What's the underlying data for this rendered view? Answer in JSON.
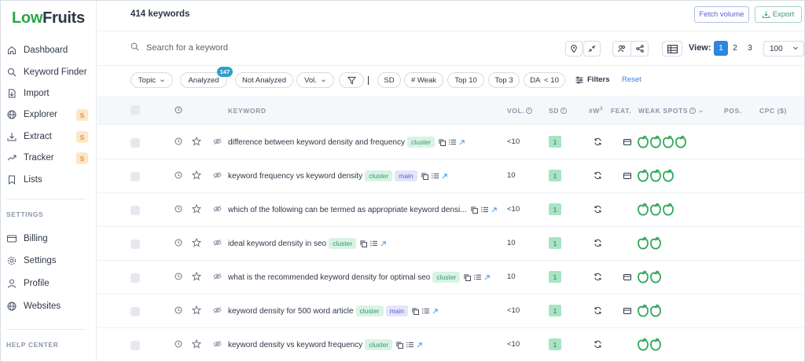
{
  "app": {
    "logo_part1": "LowFruits",
    "logo_brand_color": "#28a745"
  },
  "sidebar": {
    "items": [
      {
        "label": "Dashboard",
        "icon": "home-icon"
      },
      {
        "label": "Keyword Finder",
        "icon": "search-icon"
      },
      {
        "label": "Import",
        "icon": "import-icon"
      },
      {
        "label": "Explorer",
        "icon": "globe-icon",
        "badge": "S"
      },
      {
        "label": "Extract",
        "icon": "download-icon",
        "badge": "S"
      },
      {
        "label": "Tracker",
        "icon": "trend-icon",
        "badge": "S"
      },
      {
        "label": "Lists",
        "icon": "bookmark-icon"
      }
    ],
    "settings_heading": "SETTINGS",
    "settings_items": [
      {
        "label": "Billing",
        "icon": "card-icon"
      },
      {
        "label": "Settings",
        "icon": "gear-icon"
      },
      {
        "label": "Profile",
        "icon": "user-icon"
      },
      {
        "label": "Websites",
        "icon": "globe-icon"
      }
    ],
    "help_heading": "HELP CENTER"
  },
  "header": {
    "keyword_count": "414 keywords",
    "fetch_volume_label": "Fetch volume",
    "export_label": "Export"
  },
  "search": {
    "placeholder": "Search for a keyword",
    "view_label": "View:",
    "pages": [
      "1",
      "2",
      "3"
    ],
    "active_page": "1",
    "per_page": "100"
  },
  "filters": {
    "topic": "Topic",
    "analyzed": "Analyzed",
    "analyzed_count": "147",
    "not_analyzed": "Not Analyzed",
    "vol": "Vol.",
    "sd": "SD",
    "weak": "# Weak",
    "top10": "Top 10",
    "top3": "Top 3",
    "da": "DA  < 10",
    "filters_label": "Filters",
    "reset_label": "Reset"
  },
  "table": {
    "headers": {
      "keyword": "KEYWORD",
      "vol": "VOL.",
      "sd": "SD",
      "weak_count": "#W",
      "weak_sup": "3",
      "feat": "FEAT.",
      "weak_spots": "WEAK SPOTS",
      "pos": "POS.",
      "cpc": "CPC ($)"
    },
    "tag_labels": {
      "cluster": "cluster",
      "main": "main"
    },
    "rows": [
      {
        "keyword": "difference between keyword density and frequency",
        "tags": [
          "cluster"
        ],
        "vol": "<10",
        "sd": "1",
        "feat": true,
        "weak_spots": 4
      },
      {
        "keyword": "keyword frequency vs keyword density",
        "tags": [
          "cluster",
          "main"
        ],
        "vol": "10",
        "sd": "1",
        "feat": true,
        "weak_spots": 3
      },
      {
        "keyword": "which of the following can be termed as appropriate keyword densi...",
        "tags": [],
        "vol": "<10",
        "sd": "1",
        "feat": false,
        "weak_spots": 3
      },
      {
        "keyword": "ideal keyword density in seo",
        "tags": [
          "cluster"
        ],
        "vol": "10",
        "sd": "1",
        "feat": false,
        "weak_spots": 2
      },
      {
        "keyword": "what is the recommended keyword density for optimal seo",
        "tags": [
          "cluster"
        ],
        "vol": "10",
        "sd": "1",
        "feat": true,
        "weak_spots": 2
      },
      {
        "keyword": "keyword density for 500 word article",
        "tags": [
          "cluster",
          "main"
        ],
        "vol": "<10",
        "sd": "1",
        "feat": true,
        "weak_spots": 2
      },
      {
        "keyword": "keyword density vs keyword frequency",
        "tags": [
          "cluster"
        ],
        "vol": "<10",
        "sd": "1",
        "feat": false,
        "weak_spots": 2
      }
    ]
  },
  "colors": {
    "accent_green": "#28a745",
    "link_blue": "#2e86de",
    "fetch_purple": "#5a5fd6",
    "export_green": "#3a9a78",
    "badge_orange": "#e8913a",
    "sd_green": "#a7e4c4"
  }
}
